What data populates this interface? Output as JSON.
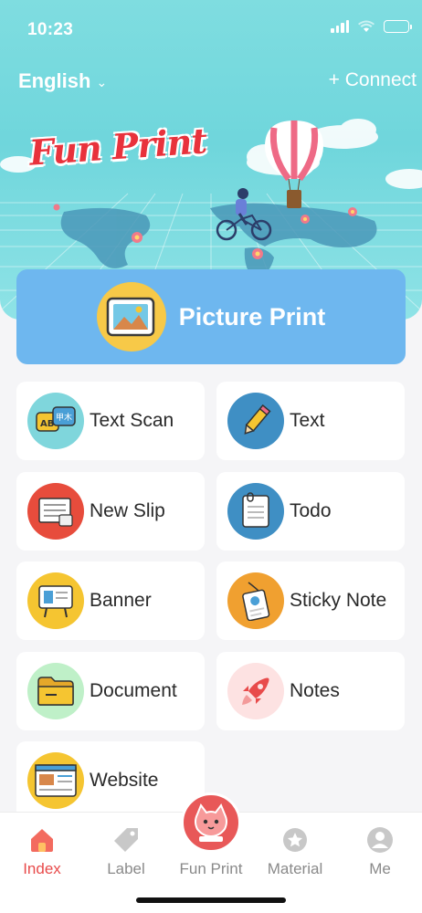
{
  "status_bar": {
    "time": "10:23"
  },
  "header": {
    "language": "English",
    "connect": "+ Connect",
    "logo_text": "Fun Print"
  },
  "picture_print": {
    "label": "Picture Print",
    "icon": "picture-icon"
  },
  "features": [
    {
      "label": "Text Scan",
      "icon": "text-scan-icon",
      "color": "#7fd6dc"
    },
    {
      "label": "Text",
      "icon": "pencil-icon",
      "color": "#3f8fc4"
    },
    {
      "label": "New Slip",
      "icon": "slip-icon",
      "color": "#e74c3c"
    },
    {
      "label": "Todo",
      "icon": "todo-icon",
      "color": "#3f8fc4"
    },
    {
      "label": "Banner",
      "icon": "banner-icon",
      "color": "#f5c531"
    },
    {
      "label": "Sticky Note",
      "icon": "sticky-note-icon",
      "color": "#f0a030"
    },
    {
      "label": "Document",
      "icon": "folder-icon",
      "color": "#bff0c8"
    },
    {
      "label": "Notes",
      "icon": "rocket-icon",
      "color": "#fde2e2"
    },
    {
      "label": "Website",
      "icon": "website-icon",
      "color": "#f5c531"
    }
  ],
  "tabbar": {
    "tabs": [
      {
        "label": "Index",
        "icon": "home-icon",
        "active": true
      },
      {
        "label": "Label",
        "icon": "tag-icon",
        "active": false
      },
      {
        "label": "Fun Print",
        "icon": "cat-icon",
        "active": false
      },
      {
        "label": "Material",
        "icon": "star-badge-icon",
        "active": false
      },
      {
        "label": "Me",
        "icon": "user-icon",
        "active": false
      }
    ]
  },
  "colors": {
    "hero": "#7fdde0",
    "picture_print_bg": "#6eb7ef",
    "active_tab": "#e84b4b",
    "logo": "#e8323c"
  }
}
